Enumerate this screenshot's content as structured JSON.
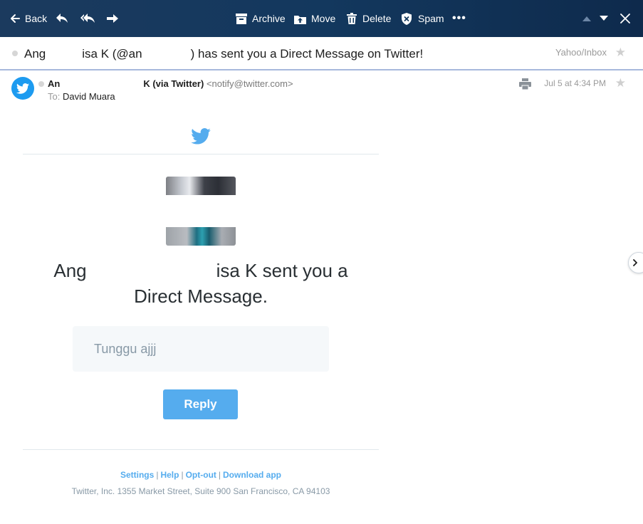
{
  "toolbar": {
    "back_label": "Back",
    "archive_label": "Archive",
    "move_label": "Move",
    "delete_label": "Delete",
    "spam_label": "Spam",
    "more_label": "•••"
  },
  "subject": {
    "text": "Ang   isa K (@an    ) has sent you a Direct Message on Twitter!",
    "folder": "Yahoo/Inbox"
  },
  "message": {
    "sender_name": "An         K (via Twitter)",
    "sender_email": "<notify@twitter.com>",
    "to_label": "To:",
    "to_name": "David Muara",
    "date": "Jul 5 at 4:34 PM"
  },
  "body": {
    "headline_line1": "Ang       isa K sent you a",
    "headline_line2": "Direct Message.",
    "dm_text": "Tunggu ajjj",
    "reply_label": "Reply"
  },
  "footer": {
    "links": [
      "Settings",
      "Help",
      "Opt-out",
      "Download app"
    ],
    "separator": "|",
    "address": "Twitter, Inc. 1355 Market Street, Suite 900 San Francisco, CA 94103"
  },
  "colors": {
    "toolbar_bg": "#13385e",
    "twitter_blue": "#1d9bf0",
    "reply_button": "#55acee",
    "link": "#55acee"
  },
  "icons": {
    "back": "arrow-left-icon",
    "reply": "reply-icon",
    "reply_all": "reply-all-icon",
    "forward": "forward-icon",
    "archive": "archive-icon",
    "move": "move-icon",
    "delete": "trash-icon",
    "spam": "shield-x-icon",
    "prev": "caret-up-icon",
    "next": "caret-down-icon",
    "close": "close-icon",
    "print": "print-icon",
    "twitter": "twitter-bird-icon",
    "next_circle": "chevron-right-icon"
  }
}
